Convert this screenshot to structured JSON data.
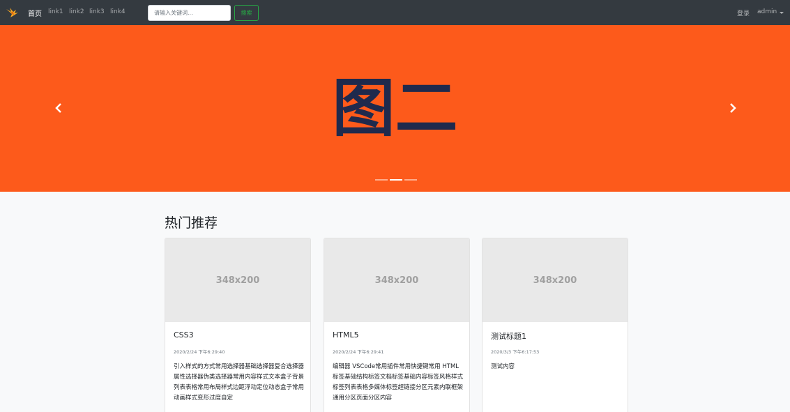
{
  "navbar": {
    "home": "首页",
    "links": [
      "link1",
      "link2",
      "link3",
      "link4"
    ],
    "search_placeholder": "请输入关键词...",
    "search_button": "搜索",
    "login": "登录",
    "user": "admin"
  },
  "carousel": {
    "slide_text": "图二",
    "background": "#fd5a1b",
    "text_color": "#1f2a4d",
    "slide_count": 3,
    "active_index": 1
  },
  "section": {
    "title": "热门推荐",
    "cards": [
      {
        "image_label": "348x200",
        "title": "CSS3",
        "date": "2020/2/24 下午6:29:40",
        "text": "引入样式的方式常用选择器基础选择器复合选择器属性选择器伪类选择器常用内容样式文本盒子背景列表表格常用布局样式边距浮动定位动态盒子常用动画样式变形过度自定"
      },
      {
        "image_label": "348x200",
        "title": "HTML5",
        "date": "2020/2/24 下午6:29:41",
        "text": "编辑器 VSCode常用插件常用快捷键常用 HTML 标签基础结构标签文档标签基础内容标签风格样式标签列表表格多媒体标签超链接分区元素内联框架通用分区页面分区内容"
      },
      {
        "image_label": "348x200",
        "title": "测试标题1",
        "date": "2020/3/3 下午6:17:53",
        "text": "测试内容"
      }
    ]
  }
}
